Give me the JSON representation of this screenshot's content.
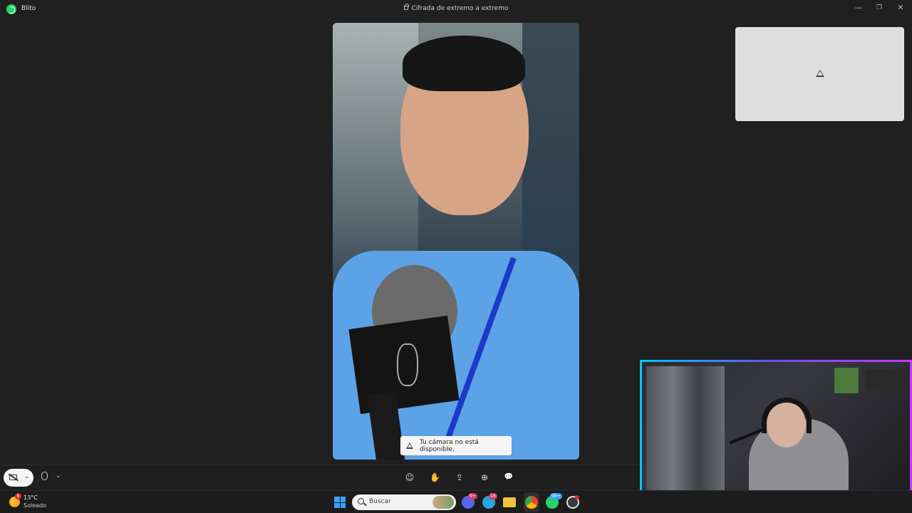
{
  "window": {
    "app_name": "Blito",
    "title": "Cifrada de extremo a extremo",
    "minimize_glyph": "—",
    "restore_glyph": "❐",
    "close_glyph": "✕"
  },
  "call": {
    "toast_text": "Tu cámara no está disponible.",
    "camera_chevron": "⌄",
    "mic_chevron": "⌄",
    "controls": [
      {
        "name": "emoji-icon",
        "glyph": "☺"
      },
      {
        "name": "raise-hand-icon",
        "glyph": "✋"
      },
      {
        "name": "share-screen-icon",
        "glyph": "⇪"
      },
      {
        "name": "add-participant-icon",
        "glyph": "⊕"
      },
      {
        "name": "chat-icon",
        "glyph": "💬"
      }
    ]
  },
  "taskbar": {
    "weather_badge": "6",
    "temperature": "13°C",
    "condition": "Soleado",
    "search_placeholder": "Buscar",
    "apps": [
      {
        "name": "discord-icon",
        "color": "#5865f2",
        "badge": "9+"
      },
      {
        "name": "telegram-icon",
        "color": "#2aa3de",
        "badge": "16"
      },
      {
        "name": "file-explorer-icon",
        "color": "#f2c23a",
        "badge": ""
      },
      {
        "name": "chrome-icon",
        "color": "#4a8af4",
        "badge": ""
      },
      {
        "name": "whatsapp-icon",
        "color": "#25d366",
        "badge": "99+"
      },
      {
        "name": "obs-icon",
        "color": "#3a3a3a",
        "badge": ""
      }
    ]
  },
  "colors": {
    "accent_green": "#25d366",
    "background": "#202020",
    "overlay_border_start": "#00c8ff",
    "overlay_border_end": "#c23cff"
  }
}
